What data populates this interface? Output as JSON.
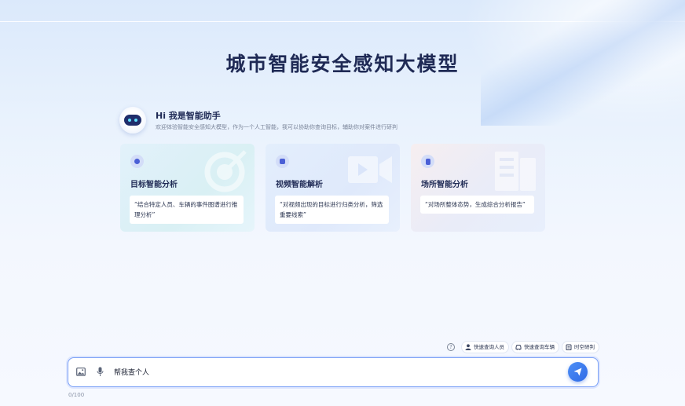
{
  "page": {
    "title": "城市智能安全感知大模型"
  },
  "assistant": {
    "greeting": "Hi  我是智能助手",
    "intro": "欢迎体验智能安全感知大模型，作为一个人工智能，我可以协助你查询目标，辅助你对案件进行研判"
  },
  "cards": [
    {
      "title": "目标智能分析",
      "quote": "“结合特定人员、车辆的事件图谱进行推理分析”",
      "icon": "target-icon"
    },
    {
      "title": "视频智能解析",
      "quote": "“对视频出现的目标进行归类分析，筛选重要线索”",
      "icon": "video-icon"
    },
    {
      "title": "场所智能分析",
      "quote": "“对场所整体态势，生成综合分析报告”",
      "icon": "building-icon"
    }
  ],
  "quick_actions": {
    "help_glyph": "?",
    "items": [
      {
        "label": "快速查询人员",
        "icon": "person-icon"
      },
      {
        "label": "快速查询车辆",
        "icon": "car-icon"
      },
      {
        "label": "时空研判",
        "icon": "clipboard-icon"
      }
    ]
  },
  "input": {
    "value": "帮我查个人",
    "counter": "0/100"
  }
}
